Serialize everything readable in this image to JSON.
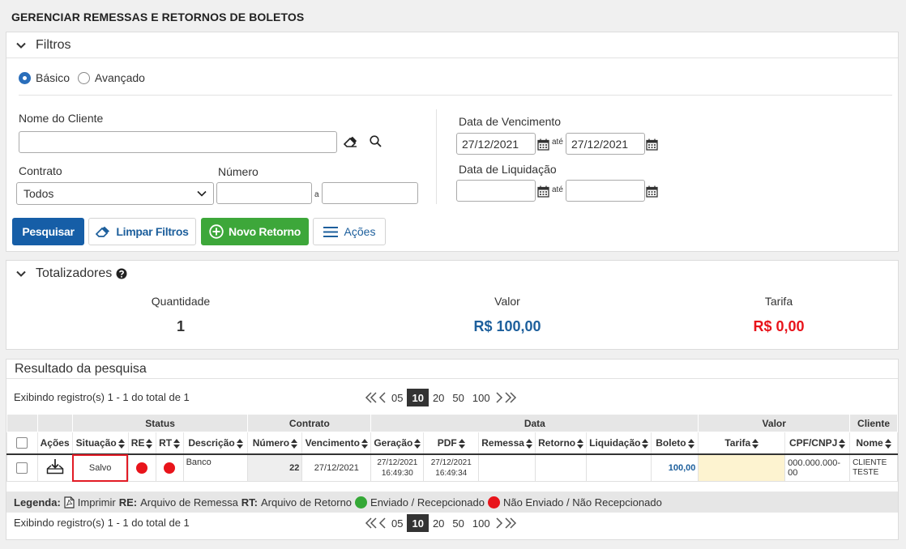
{
  "page": {
    "title": "GERENCIAR REMESSAS E RETORNOS DE BOLETOS"
  },
  "filters": {
    "title": "Filtros",
    "mode_basic": "Básico",
    "mode_advanced": "Avançado",
    "client_label": "Nome do Cliente",
    "client_value": "",
    "contract_label": "Contrato",
    "contract_selected": "Todos",
    "number_label": "Número",
    "number_sep": "a",
    "due_label": "Data de Vencimento",
    "due_from": "27/12/2021",
    "due_to": "27/12/2021",
    "until": "até",
    "liq_label": "Data de Liquidação",
    "liq_from": "",
    "liq_to": "",
    "btn_search": "Pesquisar",
    "btn_clear": "Limpar Filtros",
    "btn_new_return": "Novo Retorno",
    "btn_actions": "Ações"
  },
  "totals": {
    "title": "Totalizadores",
    "quantity_label": "Quantidade",
    "quantity_value": "1",
    "value_label": "Valor",
    "value_value": "R$ 100,00",
    "fee_label": "Tarifa",
    "fee_value": "R$ 0,00"
  },
  "results": {
    "title": "Resultado da pesquisa",
    "summary": "Exibindo registro(s) 1 - 1 do total de 1",
    "page_sizes": [
      "05",
      "10",
      "20",
      "50",
      "100"
    ],
    "active_page_size": "10",
    "groups": {
      "status": "Status",
      "contract": "Contrato",
      "date": "Data",
      "value": "Valor",
      "client": "Cliente"
    },
    "columns": {
      "actions": "Ações",
      "situation": "Situação",
      "re": "RE",
      "rt": "RT",
      "description": "Descrição",
      "number": "Número",
      "due": "Vencimento",
      "generation": "Geração",
      "pdf": "PDF",
      "remittance": "Remessa",
      "return": "Retorno",
      "liquidation": "Liquidação",
      "boleto": "Boleto",
      "fee": "Tarifa",
      "doc": "CPF/CNPJ",
      "name": "Nome"
    },
    "rows": [
      {
        "situation": "Salvo",
        "description": "Banco",
        "number": "22",
        "due": "27/12/2021",
        "generation_date": "27/12/2021",
        "generation_time": "16:49:30",
        "pdf_date": "27/12/2021",
        "pdf_time": "16:49:34",
        "remittance": "",
        "return": "",
        "liquidation": "",
        "boleto": "100,00",
        "fee": "",
        "doc": "000.000.000-00",
        "name_line1": "CLIENTE",
        "name_line2": "TESTE"
      }
    ],
    "legend": {
      "title": "Legenda:",
      "print": "Imprimir",
      "re_abbr": "RE:",
      "re_text": "Arquivo de Remessa",
      "rt_abbr": "RT:",
      "rt_text": "Arquivo de Retorno",
      "sent": "Enviado / Recepcionado",
      "not_sent": "Não Enviado / Não Recepcionado"
    }
  },
  "colors": {
    "primary": "#165ea7",
    "success": "#3da73a",
    "danger": "#e8141b",
    "value_blue": "#1d5f9c"
  }
}
